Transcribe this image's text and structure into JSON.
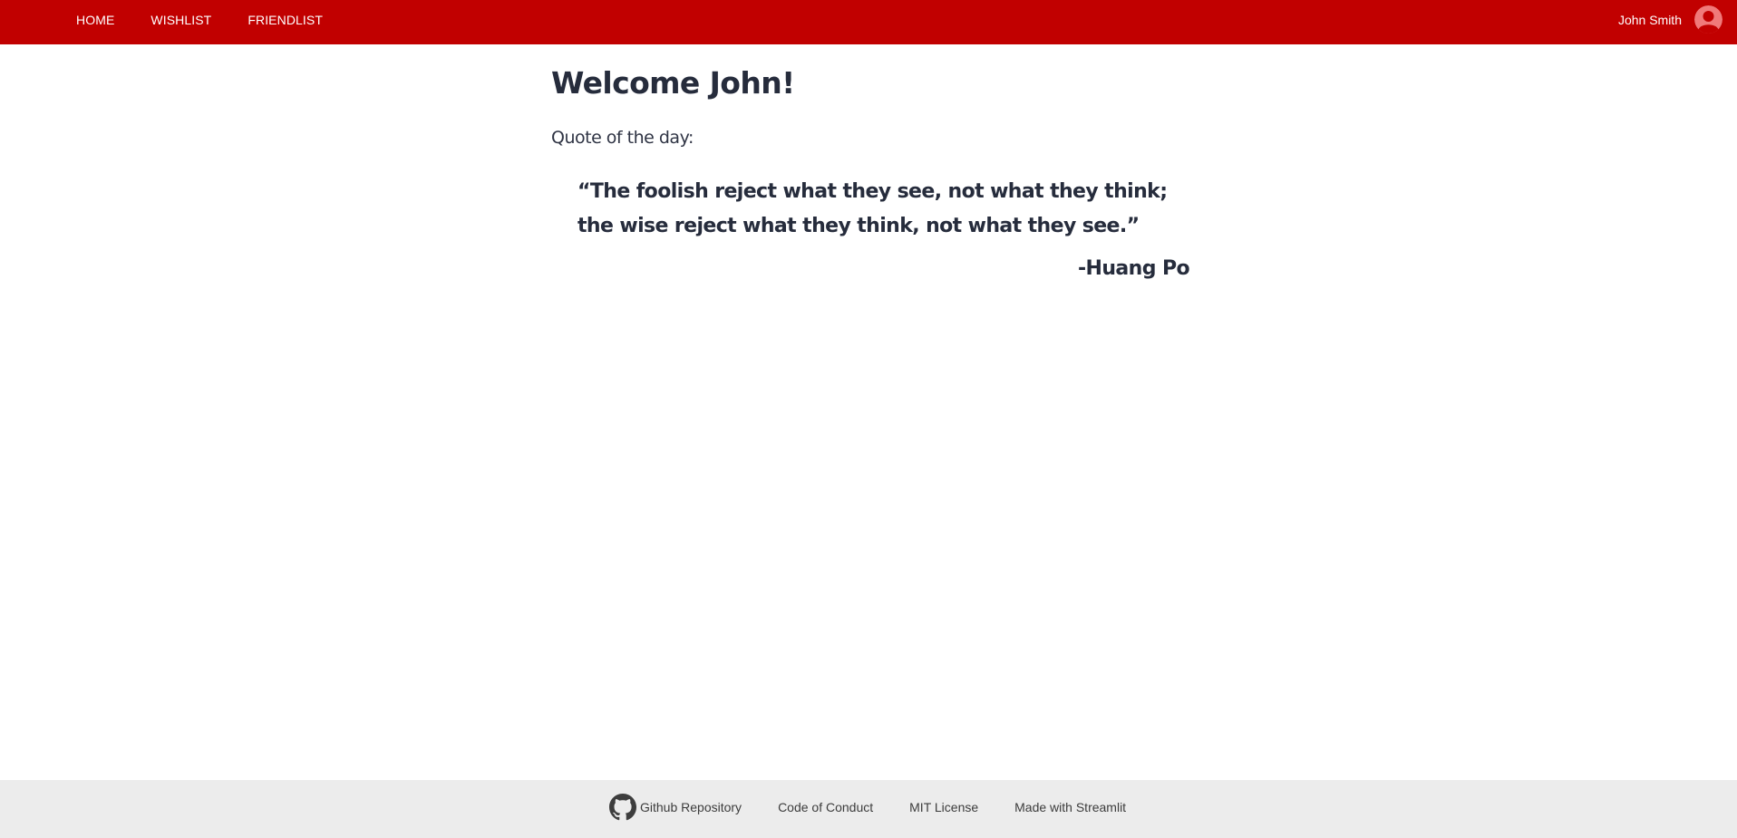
{
  "nav": {
    "links": [
      "HOME",
      "WISHLIST",
      "FRIENDLIST"
    ],
    "user_name": "John Smith",
    "avatar_icon": "user-avatar-icon",
    "brand_color": "#c10000"
  },
  "main": {
    "title": "Welcome John!",
    "quote_label": "Quote of the day:",
    "quote_text": "“The foolish reject what they see, not what they think; the wise reject what they think, not what they see.”",
    "quote_author": "-Huang Po"
  },
  "footer": {
    "github_icon": "github-icon",
    "links": [
      "Github Repository",
      "Code of Conduct",
      "MIT License",
      "Made with Streamlit"
    ]
  }
}
